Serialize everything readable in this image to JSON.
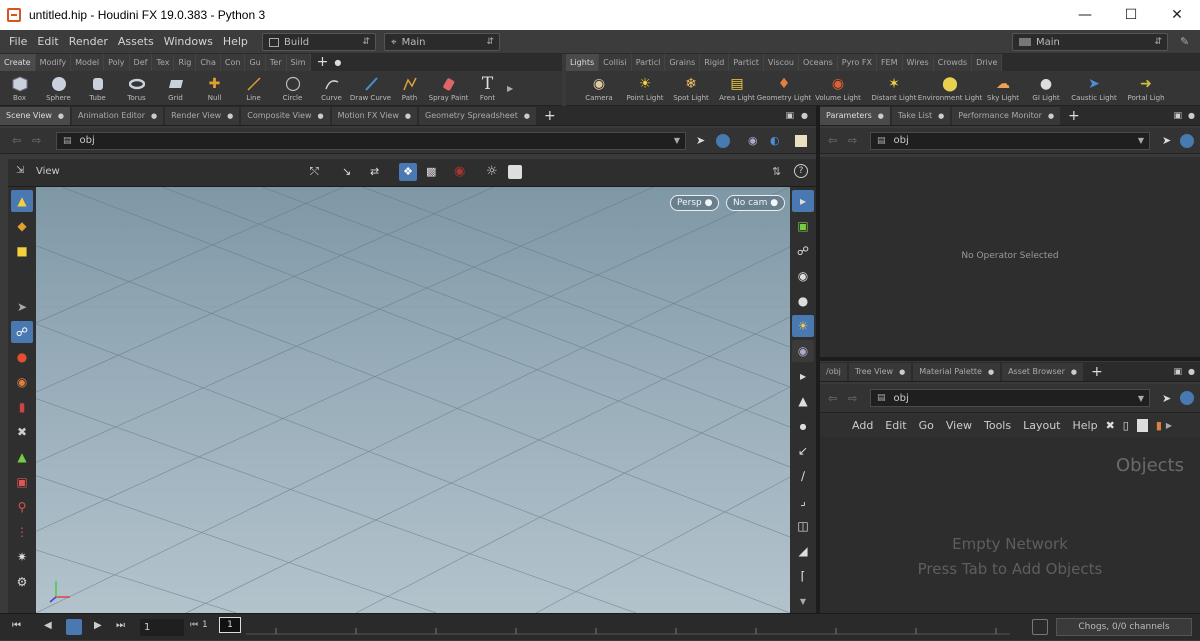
{
  "window": {
    "title": "untitled.hip - Houdini FX 19.0.383 - Python 3"
  },
  "menubar": {
    "items": [
      "File",
      "Edit",
      "Render",
      "Assets",
      "Windows",
      "Help"
    ],
    "desktop_select": "Build",
    "workspace_select": "Main",
    "right_select": "Main"
  },
  "shelf_left": {
    "tabs": [
      "Create",
      "Modify",
      "Model",
      "Poly",
      "Def",
      "Tex",
      "Rig",
      "Cha",
      "Con",
      "Gu",
      "Ter",
      "Sim"
    ],
    "tools": [
      {
        "label": "Box",
        "icon": "box-icon"
      },
      {
        "label": "Sphere",
        "icon": "sphere-icon"
      },
      {
        "label": "Tube",
        "icon": "tube-icon"
      },
      {
        "label": "Torus",
        "icon": "torus-icon"
      },
      {
        "label": "Grid",
        "icon": "grid-icon"
      },
      {
        "label": "Null",
        "icon": "null-icon"
      },
      {
        "label": "Line",
        "icon": "line-icon"
      },
      {
        "label": "Circle",
        "icon": "circle-icon"
      },
      {
        "label": "Curve",
        "icon": "curve-icon"
      },
      {
        "label": "Draw Curve",
        "icon": "draw-curve-icon"
      },
      {
        "label": "Path",
        "icon": "path-icon"
      },
      {
        "label": "Spray Paint",
        "icon": "spray-paint-icon"
      },
      {
        "label": "Font",
        "icon": "font-icon"
      }
    ]
  },
  "shelf_right": {
    "tabs": [
      "Lights",
      "Collisi",
      "Particl",
      "Grains",
      "Rigid",
      "Partict",
      "Viscou",
      "Oceans",
      "Pyro FX",
      "FEM",
      "Wires",
      "Crowds",
      "Drive"
    ],
    "tools": [
      {
        "label": "Camera",
        "icon": "camera-icon"
      },
      {
        "label": "Point Light",
        "icon": "point-light-icon"
      },
      {
        "label": "Spot Light",
        "icon": "spot-light-icon"
      },
      {
        "label": "Area Light",
        "icon": "area-light-icon"
      },
      {
        "label": "Geometry Light",
        "icon": "geometry-light-icon"
      },
      {
        "label": "Volume Light",
        "icon": "volume-light-icon"
      },
      {
        "label": "Distant Light",
        "icon": "distant-light-icon"
      },
      {
        "label": "Environment Light",
        "icon": "environment-light-icon"
      },
      {
        "label": "Sky Light",
        "icon": "sky-light-icon"
      },
      {
        "label": "GI Light",
        "icon": "gi-light-icon"
      },
      {
        "label": "Caustic Light",
        "icon": "caustic-light-icon"
      },
      {
        "label": "Portal Ligh",
        "icon": "portal-light-icon"
      }
    ]
  },
  "left_pane": {
    "tabs": [
      "Scene View",
      "Animation Editor",
      "Render View",
      "Composite View",
      "Motion FX View",
      "Geometry Spreadsheet"
    ],
    "path": "obj",
    "viewer_label": "View",
    "camera_button": "Persp",
    "cam_button": "No cam"
  },
  "params_pane": {
    "tabs": [
      "Parameters",
      "Take List",
      "Performance Monitor"
    ],
    "path": "obj",
    "empty_text": "No Operator Selected"
  },
  "network_pane": {
    "tabs": [
      "Tree View",
      "Material Palette",
      "Asset Browser"
    ],
    "path": "obj",
    "menu": [
      "Add",
      "Edit",
      "Go",
      "View",
      "Tools",
      "Layout",
      "Help"
    ],
    "context_label": "Objects",
    "empty_title": "Empty Network",
    "empty_hint": "Press Tab to Add Objects"
  },
  "timeline": {
    "frame": "1",
    "start": "1",
    "status": "Chogs, 0/0 channels"
  },
  "colors": {
    "accent_orange": "#e0a030",
    "selected_blue": "#4a78b0"
  }
}
